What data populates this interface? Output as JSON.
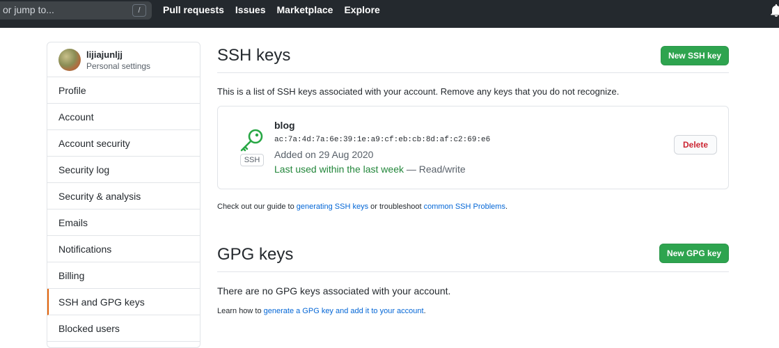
{
  "topbar": {
    "search_placeholder": "or jump to...",
    "slash_key": "/",
    "nav": [
      "Pull requests",
      "Issues",
      "Marketplace",
      "Explore"
    ],
    "bell_icon": "bell-icon"
  },
  "sidebar": {
    "username": "lijiajunljj",
    "subtitle": "Personal settings",
    "items": [
      {
        "label": "Profile"
      },
      {
        "label": "Account"
      },
      {
        "label": "Account security"
      },
      {
        "label": "Security log"
      },
      {
        "label": "Security & analysis"
      },
      {
        "label": "Emails"
      },
      {
        "label": "Notifications"
      },
      {
        "label": "Billing"
      },
      {
        "label": "SSH and GPG keys",
        "selected": true
      },
      {
        "label": "Blocked users"
      }
    ]
  },
  "ssh": {
    "title": "SSH keys",
    "new_button": "New SSH key",
    "description": "This is a list of SSH keys associated with your account. Remove any keys that you do not recognize.",
    "key": {
      "icon": "key-icon",
      "type_label": "SSH",
      "name": "blog",
      "fingerprint": "ac:7a:4d:7a:6e:39:1e:a9:cf:eb:cb:8d:af:c2:69:e6",
      "added": "Added on 29 Aug 2020",
      "last_used": "Last used within the last week",
      "access": " — Read/write",
      "delete_button": "Delete"
    },
    "guide_prefix": "Check out our guide to ",
    "guide_link1": "generating SSH keys",
    "guide_middle": " or troubleshoot ",
    "guide_link2": "common SSH Problems",
    "guide_suffix": "."
  },
  "gpg": {
    "title": "GPG keys",
    "new_button": "New GPG key",
    "empty_text": "There are no GPG keys associated with your account.",
    "learn_prefix": "Learn how to ",
    "learn_link": "generate a GPG key and add it to your account",
    "learn_suffix": "."
  },
  "colors": {
    "header_bg": "#24292e",
    "primary_green": "#2ea44f",
    "link_blue": "#0366d6",
    "danger_red": "#cb2431",
    "selected_accent": "#e36209"
  }
}
